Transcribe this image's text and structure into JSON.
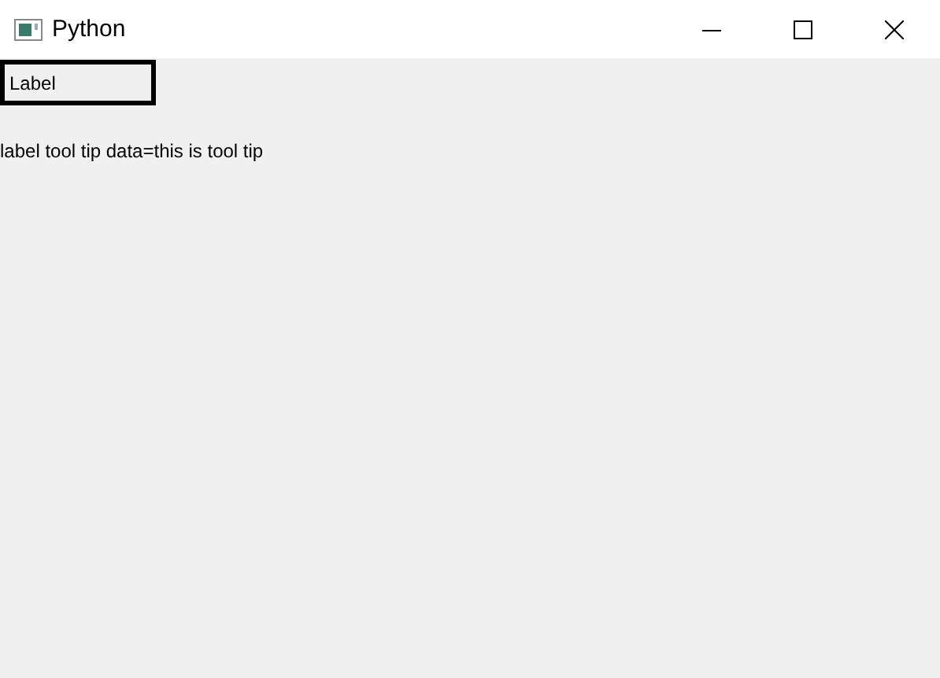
{
  "window": {
    "title": "Python"
  },
  "label": {
    "text": "Label"
  },
  "output": {
    "text": "label tool tip data=this is tool tip"
  }
}
